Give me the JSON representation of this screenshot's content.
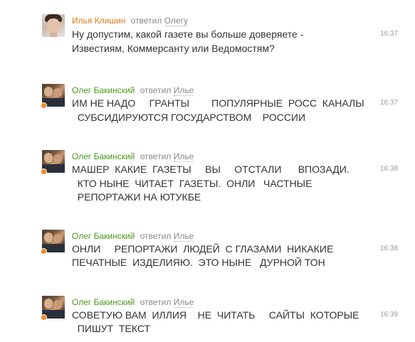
{
  "messages": [
    {
      "author": "Илья Клишин",
      "reply_verb": "ответил",
      "reply_to": "Олегу",
      "lines": [
        "Ну допустим, какой газете вы больше доверяете -",
        "Известиям, Коммерсанту или Ведомостям?"
      ],
      "time": "16:37"
    },
    {
      "author": "Олег Бакинский",
      "reply_verb": "ответил",
      "reply_to": "Илье",
      "lines": [
        "ИМ НЕ НАДО     ГРАНТЫ        ПОПУЛЯРНЫЕ  РОСС  КАНАЛЫ",
        "  СУБСИДИРУЮТСЯ ГОСУДАРСТВОМ    РОССИИ"
      ],
      "time": "16:37"
    },
    {
      "author": "Олег Бакинский",
      "reply_verb": "ответил",
      "reply_to": "Илье",
      "lines": [
        "МАШЕР  КАКИЕ  ГАЗЕТЫ     ВЫ     ОТСТАЛИ      ВПОЗАДИ.",
        "  КТО НЫНЕ  ЧИТАЕТ  ГАЗЕТЫ.  ОНЛИ   ЧАСТНЫЕ",
        "  РЕПОРТАЖИ НА ЮТУКБЕ"
      ],
      "time": "16:38"
    },
    {
      "author": "Олег Бакинский",
      "reply_verb": "ответил",
      "reply_to": "Илье",
      "lines": [
        "ОНЛИ     РЕПОРТАЖИ  ЛЮДЕЙ  С ГЛАЗАМИ  НИКАКИЕ",
        "ПЕЧАТНЫЕ  ИЗДЕЛИЯЮ.  ЭТО НЫНЕ   ДУРНОЙ ТОН"
      ],
      "time": "16:38"
    },
    {
      "author": "Олег Бакинский",
      "reply_verb": "ответил",
      "reply_to": "Илье",
      "lines": [
        "СОВЕТУЮ ВАМ  ИЛЛИЯ    НЕ  ЧИТАТЬ     САЙТЫ  КОТОРЫЕ",
        "  ПИШУТ  ТЕКСТ"
      ],
      "time": "16:39"
    }
  ],
  "colors": {
    "author_ilya": "#e07814",
    "author_oleg": "#4a9a1a",
    "online_dot": "#f08a24"
  }
}
